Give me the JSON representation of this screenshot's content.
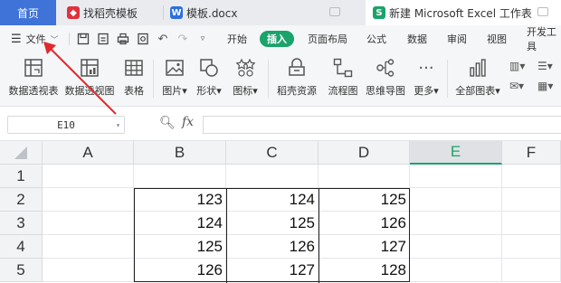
{
  "tabs": {
    "home": "首页",
    "template": "找稻壳模板",
    "doc": "模板.docx",
    "workbook": "新建 Microsoft Excel 工作表"
  },
  "menu": {
    "file": "文件",
    "items": [
      "开始",
      "插入",
      "页面布局",
      "公式",
      "数据",
      "审阅",
      "视图",
      "开发工具"
    ],
    "active_index": 1
  },
  "ribbon": {
    "buttons": [
      {
        "label": "数据透视表",
        "icon": "pivot-table-icon"
      },
      {
        "label": "数据透视图",
        "icon": "pivot-chart-icon"
      },
      {
        "label": "表格",
        "icon": "table-icon"
      },
      {
        "label": "图片",
        "icon": "picture-icon"
      },
      {
        "label": "形状",
        "icon": "shape-icon"
      },
      {
        "label": "图标",
        "icon": "icon-library-icon"
      },
      {
        "label": "稻壳资源",
        "icon": "docer-resource-icon"
      },
      {
        "label": "流程图",
        "icon": "flowchart-icon"
      },
      {
        "label": "思维导图",
        "icon": "mindmap-icon"
      },
      {
        "label": "更多",
        "icon": "more-icon"
      },
      {
        "label": "全部图表",
        "icon": "all-charts-icon"
      }
    ]
  },
  "formula_bar": {
    "name_box": "E10",
    "fx_label": "fx"
  },
  "sheet": {
    "columns": [
      "A",
      "B",
      "C",
      "D",
      "E",
      "F"
    ],
    "selected_column": "E",
    "rows": [
      "1",
      "2",
      "3",
      "4",
      "5"
    ],
    "cells": [
      [
        "",
        "",
        "",
        ""
      ],
      [
        "",
        "123",
        "124",
        "125"
      ],
      [
        "",
        "124",
        "125",
        "126"
      ],
      [
        "",
        "125",
        "126",
        "127"
      ],
      [
        "",
        "126",
        "127",
        "128"
      ]
    ]
  },
  "colors": {
    "accent_green": "#1aa36a",
    "home_tab": "#3f73d8",
    "annotation_arrow": "#e0282d"
  }
}
